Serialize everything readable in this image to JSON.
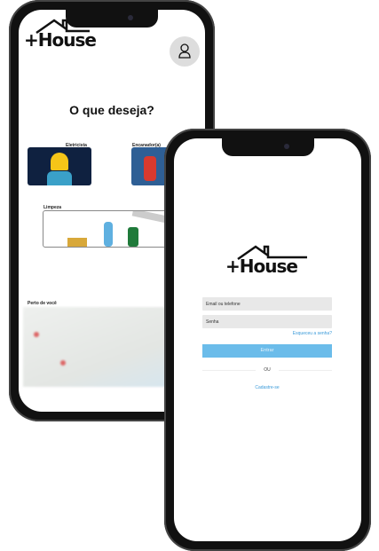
{
  "home": {
    "logo": "+House",
    "title": "O que deseja?",
    "services": [
      {
        "label": "Eletricista"
      },
      {
        "label": "Encanador(a)"
      },
      {
        "label": "Limpeza"
      }
    ],
    "nearby_label": "Perto de você",
    "profile_icon": "user-icon"
  },
  "login": {
    "logo": "+House",
    "email_placeholder": "Email ou telefone",
    "password_placeholder": "Senha",
    "forgot": "Esqueceu a senha?",
    "submit": "Entrar",
    "or": "OU",
    "signup": "Cadastre-se",
    "accent": "#6bbcea"
  }
}
